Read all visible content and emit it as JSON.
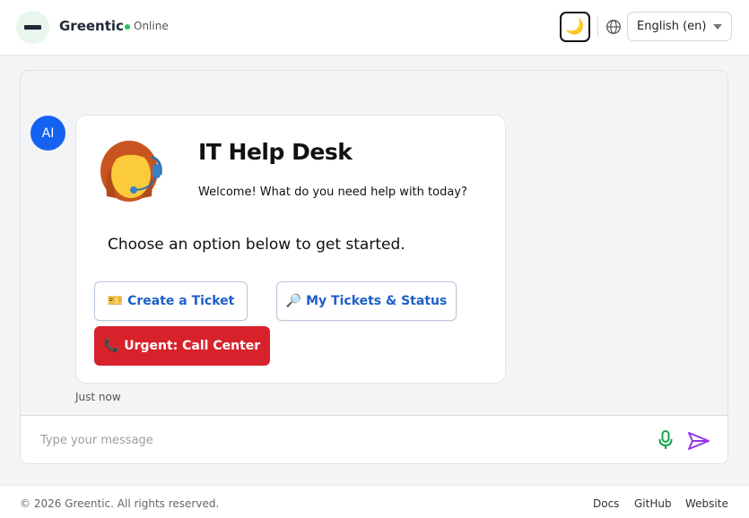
{
  "header": {
    "brand": "Greentic",
    "status": "Online",
    "theme_toggle_icon": "🌙",
    "language": "English (en)",
    "colors": {
      "status": "#22c55e",
      "logo_bg": "#e8f6ee"
    }
  },
  "chat": {
    "avatar_label": "AI",
    "card": {
      "title": "IT Help Desk",
      "subtitle": "Welcome! What do you need help with today?",
      "prompt": "Choose an option below to get started.",
      "buttons": [
        {
          "emoji": "🎫",
          "label": "Create a Ticket"
        },
        {
          "emoji": "🔎",
          "label": "My Tickets & Status"
        },
        {
          "emoji": "📞",
          "label": "Urgent: Call Center"
        }
      ]
    },
    "timestamp": "Just now",
    "composer": {
      "placeholder": "Type your message"
    },
    "colors": {
      "avatar": "#1662f0",
      "urgent": "#d7222b",
      "outline_text": "#1d5fc9",
      "mic": "#16a34a",
      "send": "#9333ea"
    }
  },
  "footer": {
    "copyright": "© 2026 Greentic. All rights reserved.",
    "links": [
      "Docs",
      "GitHub",
      "Website"
    ]
  }
}
